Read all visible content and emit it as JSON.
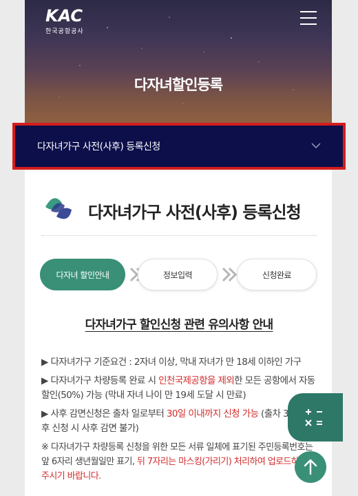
{
  "header": {
    "logo_mark": "KAC",
    "logo_sub": "한국공항공사",
    "menu_icon": "hamburger-menu-icon",
    "hero_title": "다자녀할인등록"
  },
  "dropdown": {
    "label": "다자녀가구 사전(사후) 등록신청",
    "icon": "chevron-down-icon"
  },
  "section": {
    "title": "다자녀가구 사전(사후) 등록신청"
  },
  "steps": [
    {
      "label": "다자녀 할인안내",
      "active": true
    },
    {
      "label": "정보입력",
      "active": false
    },
    {
      "label": "신청완료",
      "active": false
    }
  ],
  "notice": {
    "title": "다자녀가구 할인신청 관련 유의사항 안내",
    "item1": "▶ 다자녀가구 기준요건 : 2자녀 이상, 막내 자녀가 만 18세 이하인 가구",
    "item2_a": "▶ 다자녀가구 차량등록 완료 시 ",
    "item2_red": "인천국제공항을 제외",
    "item2_b": "한 모든 공항에서 자동 할인(50%) 가능 (막내 자녀 나이 만 19세 도달 시 만료)",
    "item3_a": "▶ 사후 감면신청은 출차 일로부터 ",
    "item3_red": "30일 이내까지 신청 가능",
    "item3_b": " (출차 30일 이후 신청 시 사후 감면 불가)",
    "item4_a": "※ 다자녀가구 차량등록 신청을 위한 모든 서류 일체에 표기된 주민등록번호는 앞 6자리 생년월일만 표기, ",
    "item4_red": "뒤 7자리는 마스킹(가리기) 처리하여 업로드하여 주시기 바랍니다."
  },
  "floating": {
    "calc_icon": "calculator-icon",
    "top_icon": "arrow-up-icon"
  },
  "colors": {
    "navy": "#0c0f4a",
    "green": "#3a9077",
    "highlight_red": "#d22b2b",
    "frame_red": "#d41d1d"
  }
}
